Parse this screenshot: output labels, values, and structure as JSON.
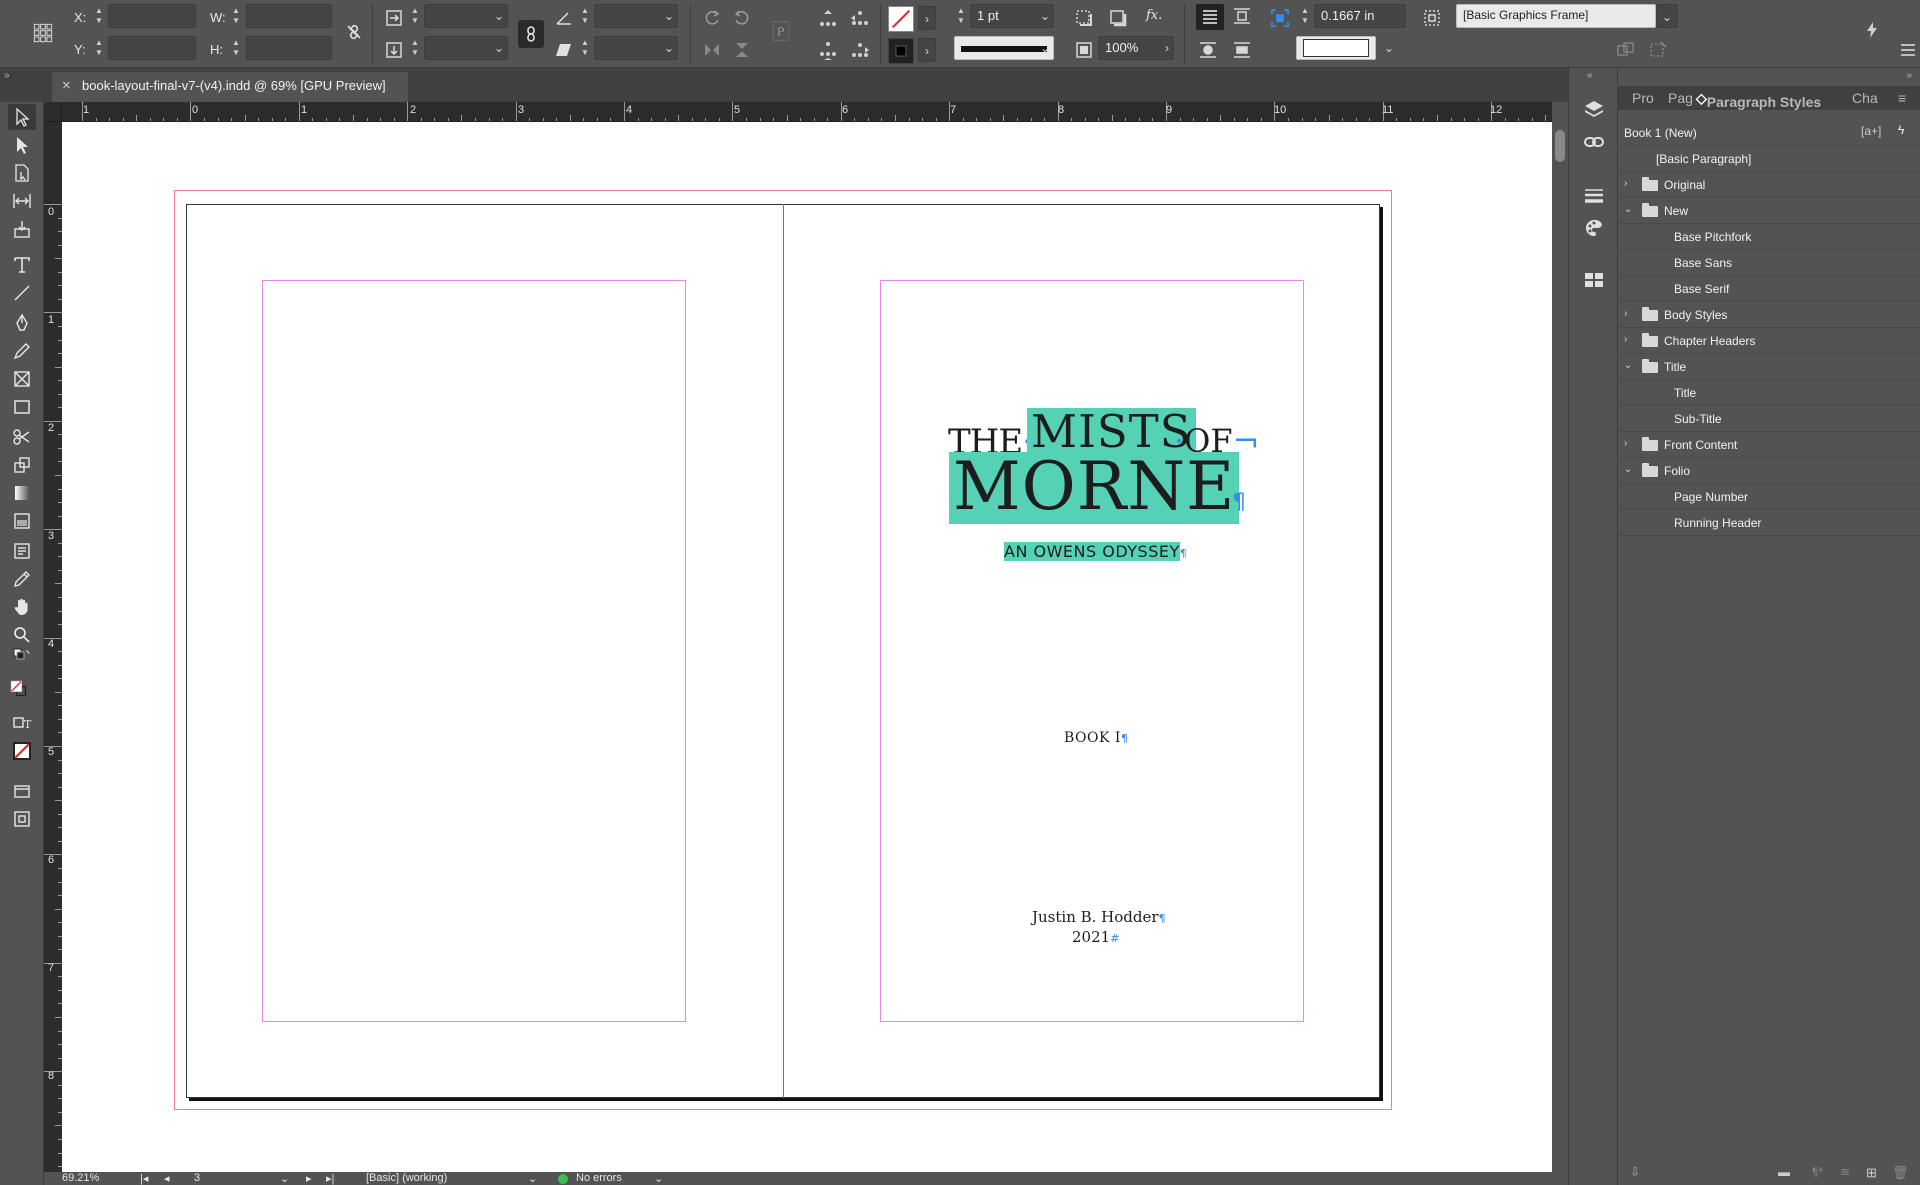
{
  "control_bar": {
    "x_label": "X:",
    "y_label": "Y:",
    "w_label": "W:",
    "h_label": "H:",
    "stroke_weight": "1 pt",
    "opacity": "100%",
    "fitting_offset": "0.1667 in",
    "object_style": "[Basic Graphics Frame]",
    "fx_label": "fx."
  },
  "document_tab": {
    "title": "book-layout-final-v7-(v4).indd @ 69% [GPU Preview]"
  },
  "ruler": {
    "h_ticks": [
      "1",
      "0",
      "1",
      "2",
      "3",
      "4",
      "5",
      "6",
      "7",
      "8",
      "9",
      "10",
      "11",
      "12"
    ],
    "v_ticks": [
      "0",
      "1",
      "2",
      "3",
      "4",
      "5",
      "6",
      "7",
      "8"
    ]
  },
  "page": {
    "title_the": "THE",
    "title_mists": "MISTS",
    "title_of": "OF",
    "title_morne": "MORNE",
    "subtitle": "AN OWENS ODYSSEY",
    "book_label": "BOOK I",
    "author": "Justin B. Hodder",
    "year": "2021",
    "pilcrow": "¶",
    "highlight_color": "#55d1b6",
    "margin_guide_color": "#e58ae8",
    "bleed_guide_color": "#f27c96"
  },
  "status_bar": {
    "zoom": "69.21%",
    "page_number": "3",
    "preflight_profile": "[Basic] (working)",
    "errors": "No errors"
  },
  "paragraph_styles_panel": {
    "tabs": [
      "Pro",
      "Pag",
      "Paragraph Styles",
      "Cha"
    ],
    "book_name": "Book 1 (New)",
    "items": [
      {
        "label": "[Basic Paragraph]",
        "type": "style"
      },
      {
        "label": "Original",
        "type": "folder",
        "expanded": false
      },
      {
        "label": "New",
        "type": "folder",
        "expanded": true
      },
      {
        "label": "Base Pitchfork",
        "type": "style"
      },
      {
        "label": "Base Sans",
        "type": "style"
      },
      {
        "label": "Base Serif",
        "type": "style"
      },
      {
        "label": "Body Styles",
        "type": "folder",
        "expanded": false
      },
      {
        "label": "Chapter Headers",
        "type": "folder",
        "expanded": false
      },
      {
        "label": "Title",
        "type": "folder",
        "expanded": true
      },
      {
        "label": "Title",
        "type": "style"
      },
      {
        "label": "Sub-Title",
        "type": "style"
      },
      {
        "label": "Front Content",
        "type": "folder",
        "expanded": false
      },
      {
        "label": "Folio",
        "type": "folder",
        "expanded": true
      },
      {
        "label": "Page Number",
        "type": "style"
      },
      {
        "label": "Running Header",
        "type": "style"
      }
    ]
  }
}
